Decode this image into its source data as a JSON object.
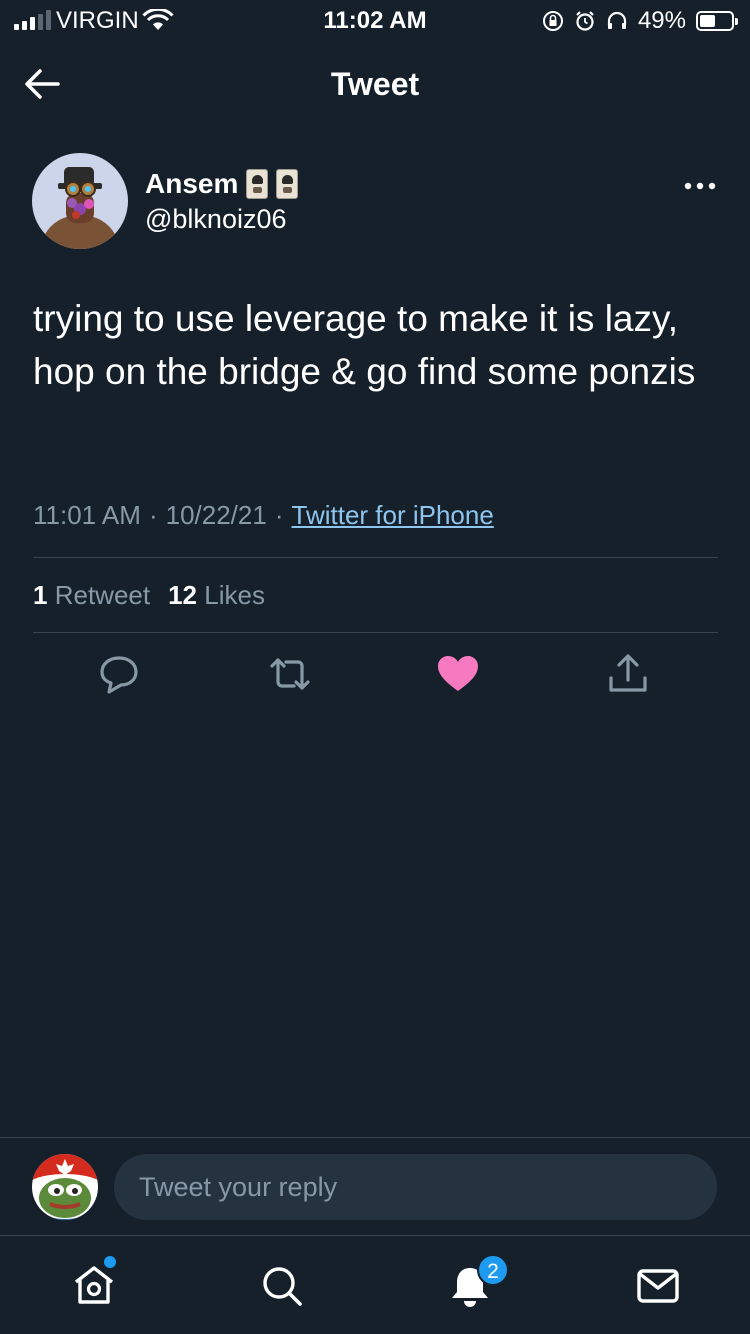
{
  "status_bar": {
    "carrier": "VIRGIN",
    "time": "11:02 AM",
    "battery": "49%",
    "battery_level": 0.49
  },
  "header": {
    "title": "Tweet"
  },
  "tweet": {
    "author_name": "Ansem",
    "author_handle": "@blknoiz06",
    "text": "trying to use leverage to make it is lazy, hop on the bridge & go find some ponzis",
    "time": "11:01 AM",
    "date": "10/22/21",
    "source": "Twitter for iPhone",
    "retweet_count": "1",
    "retweet_label": "Retweet",
    "like_count": "12",
    "like_label": "Likes",
    "liked": true,
    "like_color": "#f91880"
  },
  "reply": {
    "placeholder": "Tweet your reply"
  },
  "tab_bar": {
    "notifications_badge": "2",
    "accent_color": "#1d9bf0"
  }
}
